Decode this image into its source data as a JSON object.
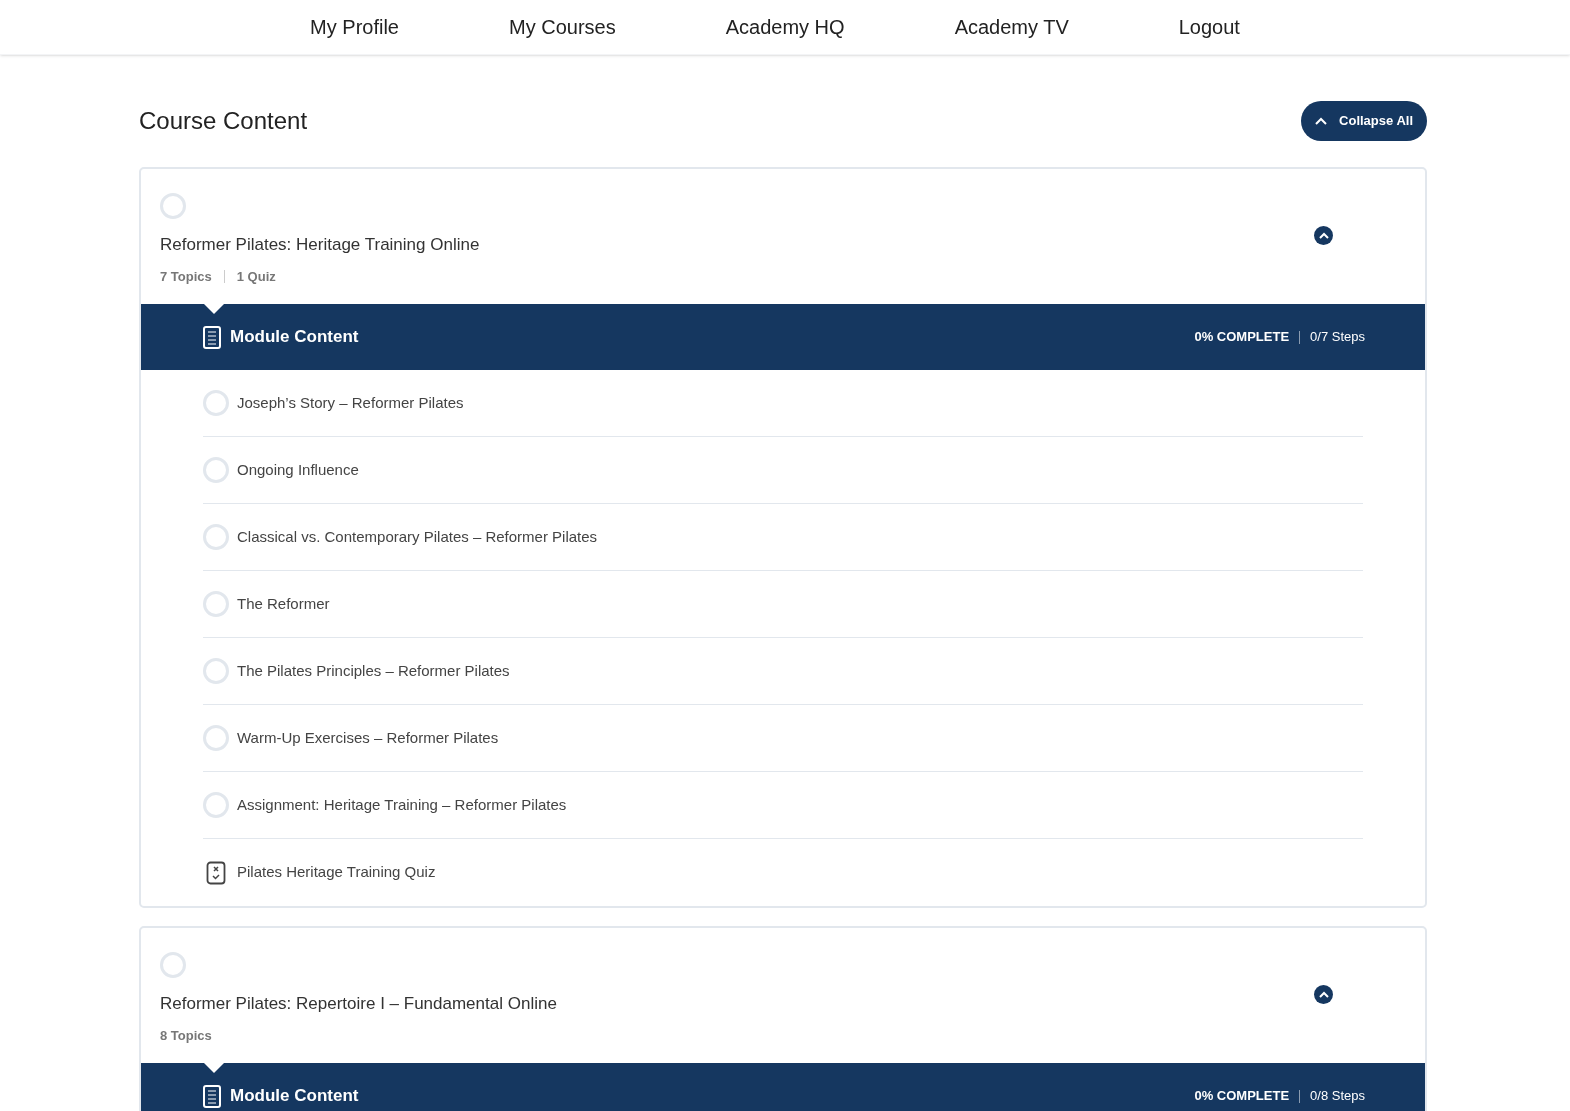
{
  "nav": [
    {
      "label": "My Profile"
    },
    {
      "label": "My Courses"
    },
    {
      "label": "Academy HQ"
    },
    {
      "label": "Academy TV"
    },
    {
      "label": "Logout"
    }
  ],
  "heading": "Course Content",
  "collapse_button": "Collapse All",
  "lessons": [
    {
      "title": "Reformer Pilates: Heritage Training Online",
      "completed": false,
      "expanded": true,
      "meta": [
        "7 Topics",
        "1 Quiz"
      ],
      "module_title": "Module Content",
      "progress": "0% COMPLETE",
      "steps": "0/7 Steps",
      "topics": [
        {
          "kind": "topic",
          "title": "Joseph’s Story – Reformer Pilates",
          "completed": false
        },
        {
          "kind": "topic",
          "title": "Ongoing Influence",
          "completed": false
        },
        {
          "kind": "topic",
          "title": "Classical vs. Contemporary Pilates – Reformer Pilates",
          "completed": false
        },
        {
          "kind": "topic",
          "title": "The Reformer",
          "completed": false
        },
        {
          "kind": "topic",
          "title": "The Pilates Principles – Reformer Pilates",
          "completed": false
        },
        {
          "kind": "topic",
          "title": "Warm-Up Exercises – Reformer Pilates",
          "completed": false
        },
        {
          "kind": "topic",
          "title": "Assignment: Heritage Training – Reformer Pilates",
          "completed": false
        },
        {
          "kind": "quiz",
          "title": "Pilates Heritage Training Quiz"
        }
      ]
    },
    {
      "title": "Reformer Pilates: Repertoire I – Fundamental Online",
      "completed": false,
      "expanded": true,
      "meta": [
        "8 Topics"
      ],
      "module_title": "Module Content",
      "progress": "0% COMPLETE",
      "steps": "0/8 Steps"
    }
  ]
}
